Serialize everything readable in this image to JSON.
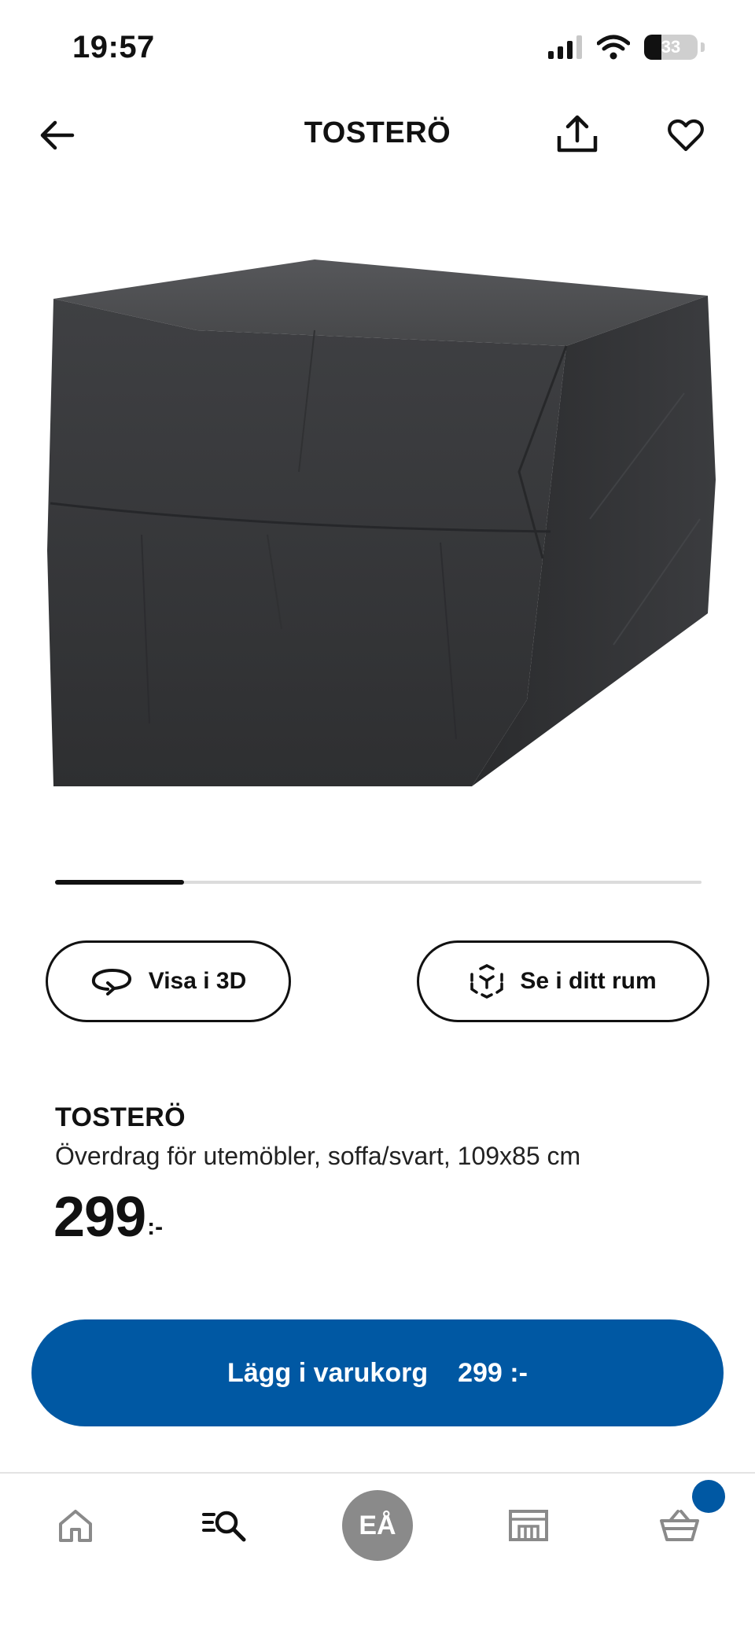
{
  "status_bar": {
    "time": "19:57",
    "battery": "33",
    "icons": [
      "signal-icon",
      "wifi-icon",
      "battery-icon"
    ]
  },
  "header": {
    "title": "TOSTERÖ",
    "icons": [
      "back-arrow-icon",
      "share-icon",
      "heart-icon"
    ]
  },
  "carousel": {
    "current_progress": 0.2
  },
  "actions": {
    "view_3d_label": "Visa i 3D",
    "view_in_room_label": "Se i ditt rum"
  },
  "product": {
    "name": "TOSTERÖ",
    "description": "Överdrag för utemöbler, soffa/svart, 109x85 cm",
    "price": "299",
    "price_suffix": ":-"
  },
  "add_to_cart": {
    "label": "Lägg i varukorg",
    "price": "299 :-"
  },
  "bottom_nav": {
    "items": [
      {
        "name": "home",
        "icon": "home-icon"
      },
      {
        "name": "search",
        "icon": "search-list-icon"
      },
      {
        "name": "profile",
        "initials": "EÅ"
      },
      {
        "name": "store",
        "icon": "store-icon"
      },
      {
        "name": "cart",
        "icon": "basket-icon"
      }
    ]
  },
  "colors": {
    "accent": "#0058a3",
    "text": "#111111",
    "avatar": "#8a8a8a"
  }
}
